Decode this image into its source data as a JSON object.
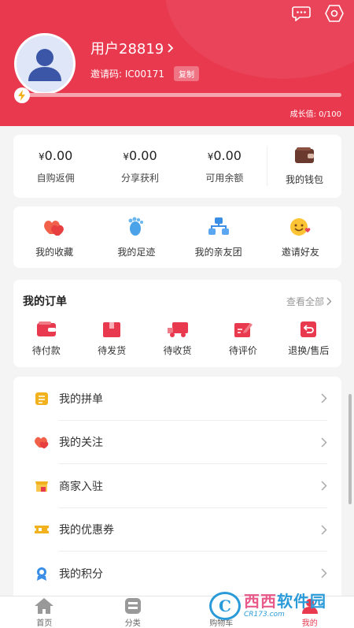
{
  "header": {
    "username": "用户28819",
    "invite_label": "邀请码:",
    "invite_code": "IC00171",
    "copy_label": "复制",
    "growth_text": "成长值: 0/100",
    "growth_progress": 0.0,
    "colors": {
      "primary": "#e8394f"
    }
  },
  "balance": {
    "items": [
      {
        "amount": "0.00",
        "currency": "¥",
        "label": "自购返佣"
      },
      {
        "amount": "0.00",
        "currency": "¥",
        "label": "分享获利"
      },
      {
        "amount": "0.00",
        "currency": "¥",
        "label": "可用余额"
      }
    ],
    "wallet_label": "我的钱包"
  },
  "quick": {
    "items": [
      {
        "label": "我的收藏",
        "icon": "hearts-icon"
      },
      {
        "label": "我的足迹",
        "icon": "footprint-icon"
      },
      {
        "label": "我的亲友团",
        "icon": "group-icon"
      },
      {
        "label": "邀请好友",
        "icon": "smile-icon"
      }
    ]
  },
  "orders": {
    "title": "我的订单",
    "view_all": "查看全部",
    "items": [
      {
        "label": "待付款",
        "icon": "wallet-pay-icon"
      },
      {
        "label": "待发货",
        "icon": "package-icon"
      },
      {
        "label": "待收货",
        "icon": "truck-icon"
      },
      {
        "label": "待评价",
        "icon": "review-icon"
      },
      {
        "label": "退换/售后",
        "icon": "return-icon"
      }
    ]
  },
  "menu": {
    "items": [
      {
        "label": "我的拼单",
        "icon": "group-order-icon"
      },
      {
        "label": "我的关注",
        "icon": "follow-icon"
      },
      {
        "label": "商家入驻",
        "icon": "merchant-icon"
      },
      {
        "label": "我的优惠券",
        "icon": "coupon-icon"
      },
      {
        "label": "我的积分",
        "icon": "points-icon"
      }
    ]
  },
  "tabbar": {
    "items": [
      {
        "label": "首页",
        "icon": "home-icon"
      },
      {
        "label": "分类",
        "icon": "category-icon"
      },
      {
        "label": "购物车",
        "icon": "cart-icon"
      },
      {
        "label": "我的",
        "icon": "user-icon",
        "active": true
      }
    ]
  },
  "watermark": {
    "logo": "C",
    "main_a": "西西",
    "main_b": "软件园",
    "sub": "CR173.com"
  }
}
